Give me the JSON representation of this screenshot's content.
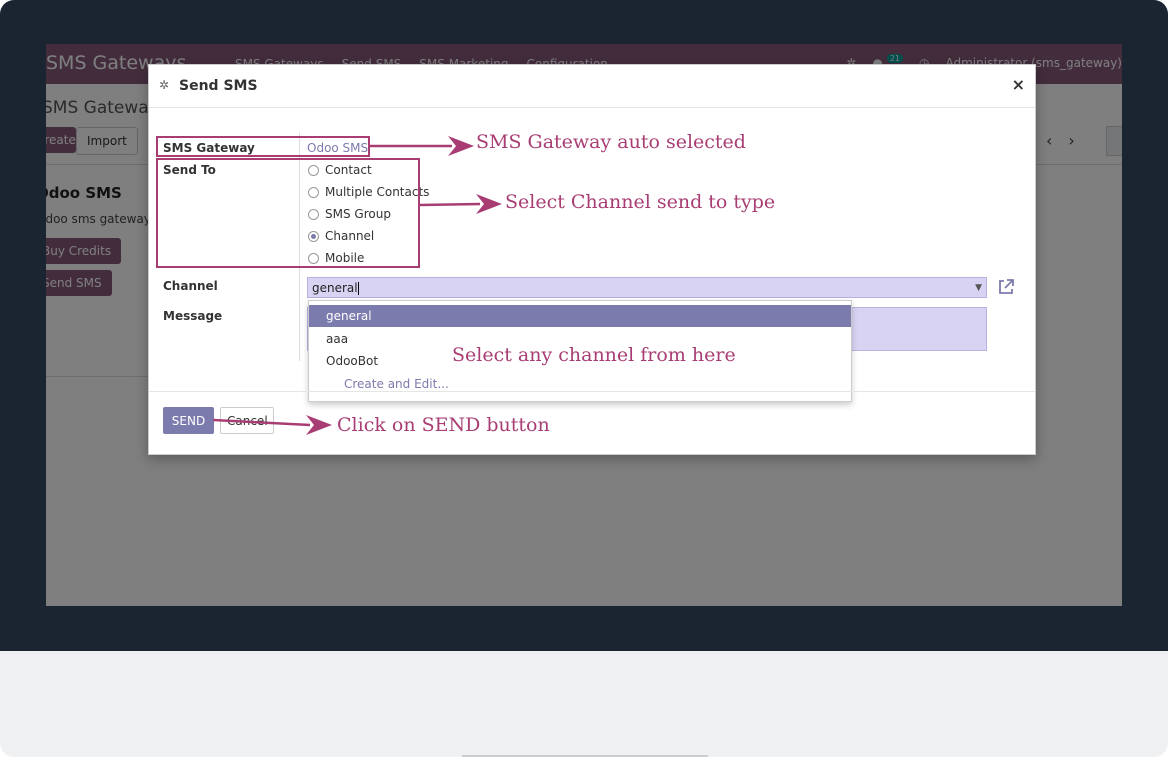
{
  "app": {
    "brand": "SMS Gateways",
    "nav": [
      "SMS Gateways",
      "Send SMS",
      "SMS Marketing",
      "Configuration"
    ],
    "notification_count": "21",
    "user": "Administrator (sms_gateway)"
  },
  "control_panel": {
    "breadcrumb": "SMS Gateways",
    "create_label": "Create",
    "import_label": "Import"
  },
  "kanban_card": {
    "title": "Odoo SMS",
    "subtitle": "Odoo sms gateway",
    "buy_credits_label": "Buy Credits",
    "send_sms_label": "Send SMS"
  },
  "dialog": {
    "title": "Send SMS",
    "close_symbol": "×",
    "fields": {
      "gateway_label": "SMS Gateway",
      "gateway_value": "Odoo SMS",
      "send_to_label": "Send To",
      "send_to_options": [
        "Contact",
        "Multiple Contacts",
        "SMS Group",
        "Channel",
        "Mobile"
      ],
      "send_to_selected": "Channel",
      "channel_label": "Channel",
      "channel_value": "general",
      "message_label": "Message"
    },
    "dropdown": {
      "options": [
        "general",
        "aaa",
        "OdooBot"
      ],
      "selected": "general",
      "create_edit": "Create and Edit..."
    },
    "footer": {
      "send_label": "SEND",
      "cancel_label": "Cancel"
    }
  },
  "annotations": {
    "gateway_note": "SMS Gateway auto selected",
    "send_to_note": "Select Channel send to type",
    "channel_note": "Select any channel from here",
    "send_note": "Click on SEND button"
  },
  "colors": {
    "brand": "#875a7b",
    "accent": "#7c7bad",
    "annotation": "#a83d73",
    "bezel": "#1b2532"
  },
  "icons": {
    "title_icon": "bug-icon",
    "external_link": "external-link-icon",
    "dropdown_caret": "caret-down-icon"
  }
}
